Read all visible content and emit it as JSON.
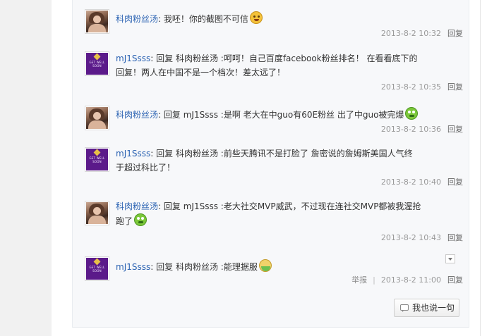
{
  "comments": [
    {
      "avatar": "photo-avatar",
      "user": "科肉粉丝汤",
      "prefix": "",
      "reply_to": "",
      "text": "我呸！你的截图不可信",
      "emoji": "cry-laugh-emoji",
      "date": "2013-8-2 10:32",
      "reply": "回复"
    },
    {
      "avatar": "get-well-soon-avatar",
      "user": "mJ1Ssss",
      "prefix": "回复",
      "reply_to": "科肉粉丝汤",
      "line1": " :呵呵！自己百度facebook粉丝排名！  在看看底下的",
      "line2": "回复！两人在中国不是一个档次！差太远了！",
      "date": "2013-8-2 10:35",
      "reply": "回复"
    },
    {
      "avatar": "photo-avatar",
      "user": "科肉粉丝汤",
      "prefix": "回复",
      "reply_to": "mJ1Ssss",
      "text": " :是啊 老大在中guo有60E粉丝 出了中guo被完爆",
      "emoji": "green-laugh-emoji",
      "date": "2013-8-2 10:36",
      "reply": "回复"
    },
    {
      "avatar": "get-well-soon-avatar",
      "user": "mJ1Ssss",
      "prefix": "回复",
      "reply_to": "科肉粉丝汤",
      "line1": " :前些天腾讯不是打脸了 詹密说的詹姆斯美国人气终",
      "line2": "于超过科比了！",
      "date": "2013-8-2 10:40",
      "reply": "回复"
    },
    {
      "avatar": "photo-avatar",
      "user": "科肉粉丝汤",
      "prefix": "回复",
      "reply_to": "mJ1Ssss",
      "line1": " :老大社交MVP威武，不过现在连社交MVP都被我渥抢",
      "line2": "跑了",
      "emoji": "green-laugh-emoji",
      "date": "2013-8-2 10:43",
      "reply": "回复"
    },
    {
      "avatar": "get-well-soon-avatar",
      "user": "mJ1Ssss",
      "prefix": "回复",
      "reply_to": "科肉粉丝汤",
      "text": " :能理据服",
      "emoji": "sick-emoji",
      "report": "举报",
      "separator": "|",
      "date": "2013-8-2 11:00",
      "reply": "回复"
    }
  ],
  "avatar_gws_text": "GET WELL SOON",
  "say_button": "我也说一句",
  "colors": {
    "username": "#2d64b3",
    "meta": "#999999",
    "gws_avatar_bg": "#5b1a8a"
  }
}
